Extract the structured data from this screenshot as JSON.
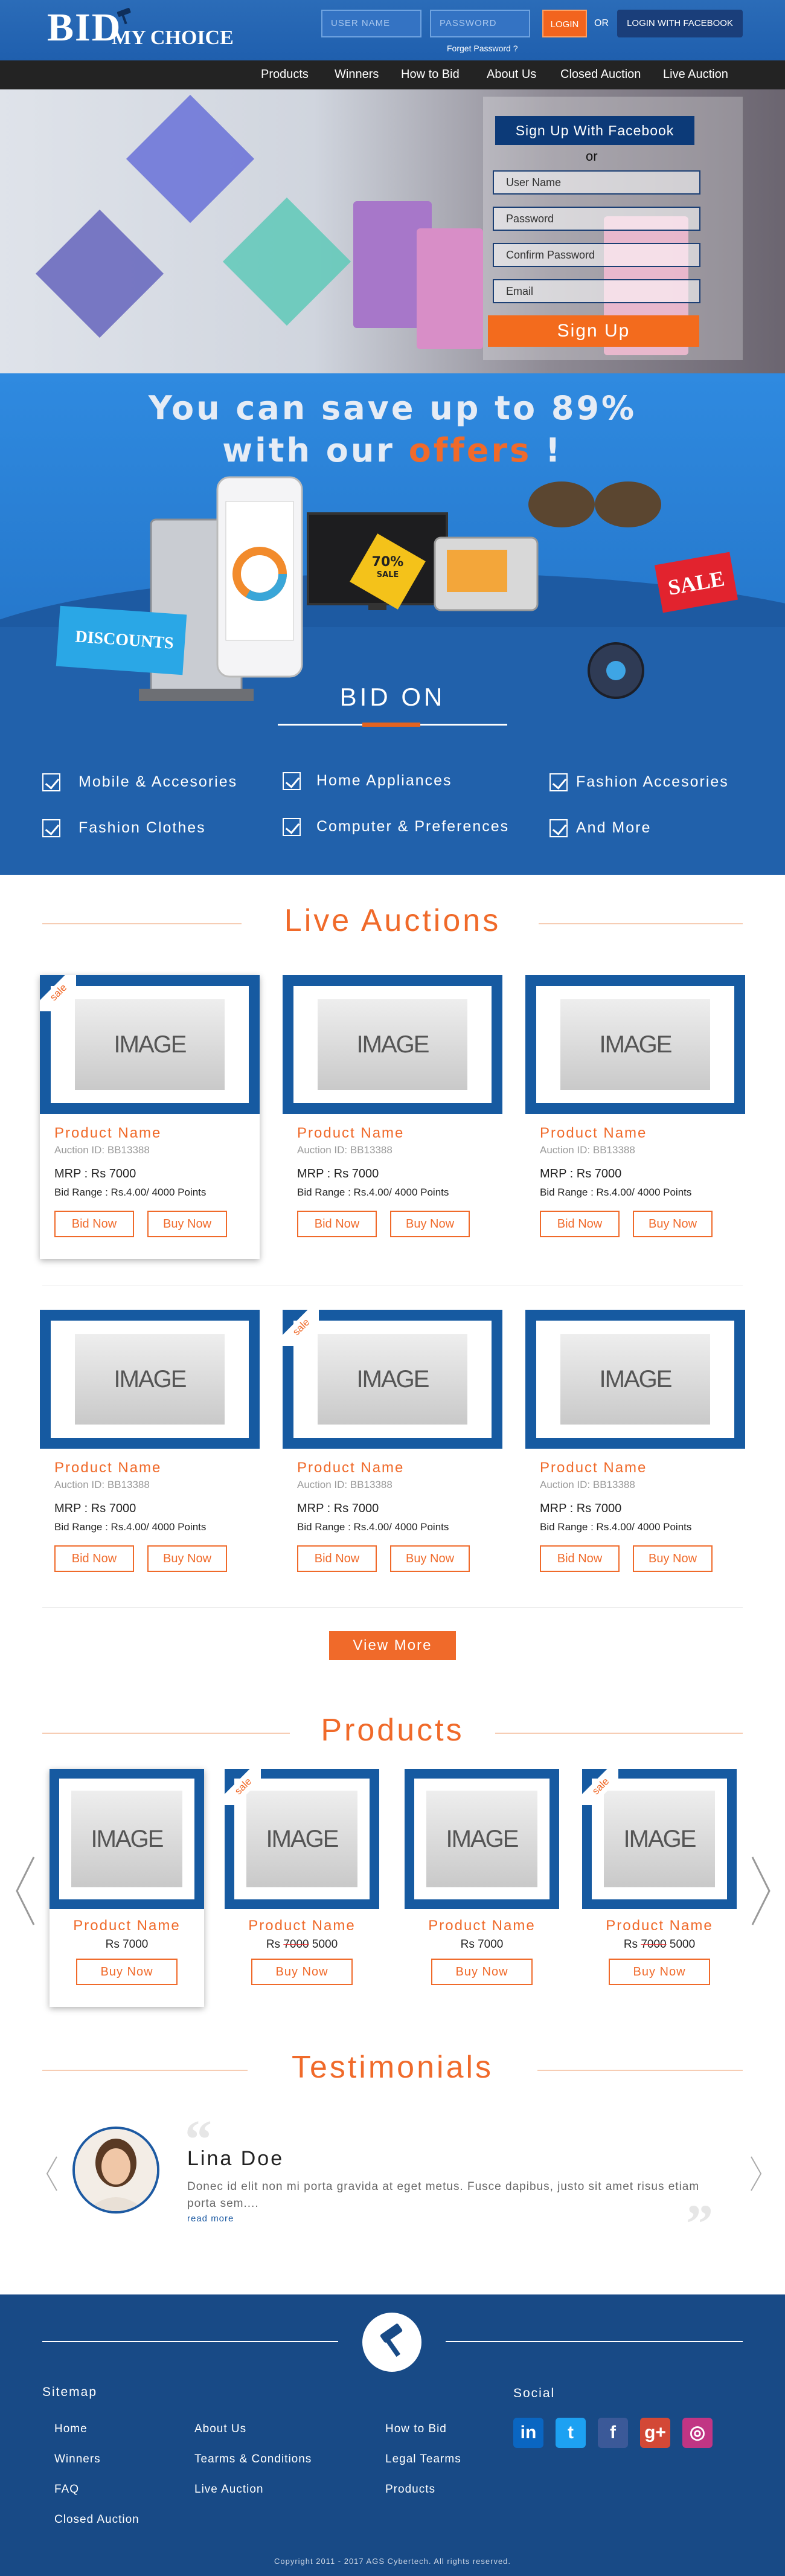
{
  "header": {
    "logo_bid": "BID",
    "logo_tagline": "MY CHOICE",
    "username_placeholder": "USER NAME",
    "password_placeholder": "PASSWORD",
    "login_label": "LOGIN",
    "or_label": "OR",
    "login_facebook_label": "LOGIN WITH FACEBOOK",
    "forgot_label": "Forget Password ?"
  },
  "nav": {
    "items": [
      "Products",
      "Winners",
      "How to Bid",
      "About Us",
      "Closed Auction",
      "Live Auction"
    ]
  },
  "signup": {
    "facebook_label": "Sign Up With Facebook",
    "or_label": "or",
    "fields": [
      "User Name",
      "Password",
      "Confirm Password",
      "Email"
    ],
    "submit_label": "Sign Up"
  },
  "offers": {
    "headline_1": "You can save up to 89%",
    "headline_2_pre": "with our",
    "headline_2_accent": "offers",
    "headline_2_post": "!",
    "badge_discounts": "DISCOUNTS",
    "badge_sale": "SALE",
    "badge_70": "70%",
    "badge_70_sub": "SALE",
    "bid_on": "BID ON",
    "categories": [
      "Mobile & Accesories",
      "Home Appliances",
      "Fashion Accesories",
      "Fashion Clothes",
      "Computer & Preferences",
      "And More"
    ]
  },
  "live_auctions": {
    "title": "Live Auctions",
    "sale_tag": "sale",
    "cards": [
      {
        "image": "IMAGE",
        "name": "Product Name",
        "auction_id": "Auction ID: BB13388",
        "mrp": "MRP : Rs 7000",
        "range": "Bid Range : Rs.4.00/ 4000 Points",
        "bid": "Bid Now",
        "buy": "Buy Now",
        "sale": true
      },
      {
        "image": "IMAGE",
        "name": "Product Name",
        "auction_id": "Auction ID: BB13388",
        "mrp": "MRP : Rs 7000",
        "range": "Bid Range : Rs.4.00/ 4000 Points",
        "bid": "Bid Now",
        "buy": "Buy Now",
        "sale": false
      },
      {
        "image": "IMAGE",
        "name": "Product Name",
        "auction_id": "Auction ID: BB13388",
        "mrp": "MRP : Rs 7000",
        "range": "Bid Range : Rs.4.00/ 4000 Points",
        "bid": "Bid Now",
        "buy": "Buy Now",
        "sale": false
      },
      {
        "image": "IMAGE",
        "name": "Product Name",
        "auction_id": "Auction ID: BB13388",
        "mrp": "MRP : Rs 7000",
        "range": "Bid Range : Rs.4.00/ 4000 Points",
        "bid": "Bid Now",
        "buy": "Buy Now",
        "sale": false
      },
      {
        "image": "IMAGE",
        "name": "Product Name",
        "auction_id": "Auction ID: BB13388",
        "mrp": "MRP : Rs 7000",
        "range": "Bid Range : Rs.4.00/ 4000 Points",
        "bid": "Bid Now",
        "buy": "Buy Now",
        "sale": true
      },
      {
        "image": "IMAGE",
        "name": "Product Name",
        "auction_id": "Auction ID: BB13388",
        "mrp": "MRP : Rs 7000",
        "range": "Bid Range : Rs.4.00/ 4000 Points",
        "bid": "Bid Now",
        "buy": "Buy Now",
        "sale": false
      }
    ],
    "view_more_label": "View More"
  },
  "products": {
    "title": "Products",
    "cards": [
      {
        "image": "IMAGE",
        "name": "Product Name",
        "price": "Rs 7000",
        "old_price": "",
        "buy": "Buy Now",
        "sale": false
      },
      {
        "image": "IMAGE",
        "name": "Product Name",
        "price_prefix": "Rs",
        "old_price": "7000",
        "price": "5000",
        "buy": "Buy Now",
        "sale": true
      },
      {
        "image": "IMAGE",
        "name": "Product Name",
        "price": "Rs 7000",
        "old_price": "",
        "buy": "Buy Now",
        "sale": false
      },
      {
        "image": "IMAGE",
        "name": "Product Name",
        "price_prefix": "Rs",
        "old_price": "7000",
        "price": "5000",
        "buy": "Buy Now",
        "sale": true
      }
    ]
  },
  "testimonials": {
    "title": "Testimonials",
    "name": "Lina Doe",
    "text": "Donec id elit non mi porta gravida at eget metus. Fusce dapibus, justo sit amet risus etiam porta sem....",
    "read_more": "read more"
  },
  "footer": {
    "sitemap_title": "Sitemap",
    "social_title": "Social",
    "links_col1": [
      "Home",
      "Winners",
      "FAQ",
      "Closed Auction"
    ],
    "links_col2": [
      "About Us",
      "Tearms & Conditions",
      "Live Auction"
    ],
    "links_col3": [
      "How to Bid",
      "Legal Tearms",
      "Products"
    ],
    "social": [
      {
        "icon": "linkedin-icon",
        "glyph": "in",
        "color": "#0a66c2"
      },
      {
        "icon": "twitter-icon",
        "glyph": "t",
        "color": "#1da1f2"
      },
      {
        "icon": "facebook-icon",
        "glyph": "f",
        "color": "#3b5998"
      },
      {
        "icon": "google-plus-icon",
        "glyph": "g+",
        "color": "#d34836"
      },
      {
        "icon": "instagram-icon",
        "glyph": "◎",
        "color": "#c13584"
      }
    ],
    "copyright": "Copyright 2011 - 2017 AGS Cybertech. All rights reserved."
  },
  "colors": {
    "brand_blue": "#1d5aa2",
    "accent_orange": "#f06a2a",
    "nav_dark": "#232323"
  }
}
